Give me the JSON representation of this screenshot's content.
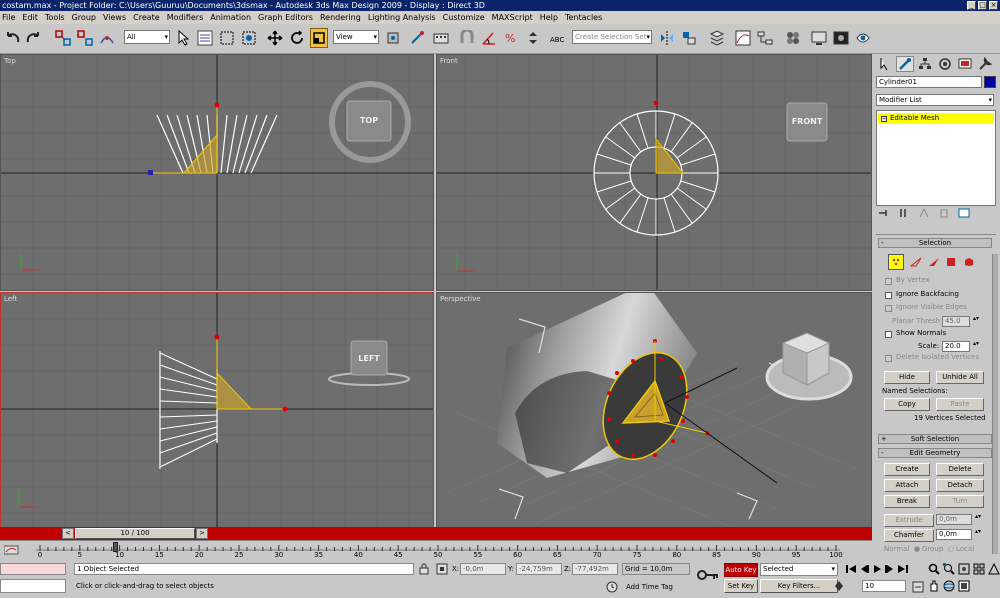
{
  "title": {
    "text": "costam.max    - Project Folder: C:\\Users\\Guuruu\\Documents\\3dsmax    - Autodesk 3ds Max Design 2009    - Display : Direct 3D"
  },
  "menu": [
    "File",
    "Edit",
    "Tools",
    "Group",
    "Views",
    "Create",
    "Modifiers",
    "Animation",
    "Graph Editors",
    "Rendering",
    "Lighting Analysis",
    "Customize",
    "MAXScript",
    "Help",
    "Tentacles"
  ],
  "toolbar": {
    "filter_value": "All",
    "refcoord_value": "View",
    "selection_set_placeholder": "Create Selection Set"
  },
  "viewports": {
    "top": {
      "label": "Top",
      "viewcube": "TOP"
    },
    "front": {
      "label": "Front",
      "viewcube": "FRONT"
    },
    "left": {
      "label": "Left",
      "viewcube": "LEFT"
    },
    "perspective": {
      "label": "Perspective"
    }
  },
  "panel": {
    "object_name": "Cylinder01",
    "modifier_list": "Modifier List",
    "stack_item": "Editable Mesh",
    "selection": {
      "title": "Selection",
      "by_vertex": "By Vertex",
      "ignore_backfacing": "Ignore Backfacing",
      "ignore_visible_edges": "Ignore Visible Edges",
      "planar_thresh_label": "Planar Thresh",
      "planar_thresh_value": "45.0",
      "show_normals": "Show Normals",
      "scale_label": "Scale:",
      "scale_value": "20.0",
      "delete_isolated": "Delete Isolated Vertices",
      "hide": "Hide",
      "unhide_all": "Unhide All",
      "named_selections": "Named Selections:",
      "copy": "Copy",
      "paste": "Paste",
      "status": "19 Vertices Selected"
    },
    "soft_selection": {
      "title": "Soft Selection"
    },
    "edit_geometry": {
      "title": "Edit Geometry",
      "create": "Create",
      "delete": "Delete",
      "attach": "Attach",
      "detach": "Detach",
      "break": "Break",
      "turn": "Turn",
      "extrude": "Extrude",
      "extrude_value": "0,0m",
      "chamfer": "Chamfer",
      "chamfer_value": "0,0m",
      "normal": "Normal",
      "group": "Group",
      "local": "Local"
    }
  },
  "timeline": {
    "frame_display": "10 / 100",
    "ticks": [
      "0",
      "5",
      "10",
      "15",
      "20",
      "25",
      "30",
      "35",
      "40",
      "45",
      "50",
      "55",
      "60",
      "65",
      "70",
      "75",
      "80",
      "85",
      "90",
      "95",
      "100"
    ],
    "current_frame": 10
  },
  "status": {
    "selection_text": "1 Object Selected",
    "prompt_text": "Click or click-and-drag to select objects",
    "x_label": "X:",
    "x_value": "-0,0m",
    "y_label": "Y:",
    "y_value": "-24,759m",
    "z_label": "Z:",
    "z_value": "-77,492m",
    "grid": "Grid = 10,0m",
    "add_time_tag": "Add Time Tag",
    "auto_key": "Auto Key",
    "set_key": "Set Key",
    "key_mode_value": "Selected",
    "key_filters": "Key Filters...",
    "frame_value": "10"
  },
  "colors": {
    "title_bg": "#0a246a",
    "timeline_red": "#c00000",
    "stack_yellow": "#ffff00",
    "active_viewport_border": "#c0302c",
    "mesh_white": "#ffffff",
    "selection_yellow": "#f0c800"
  }
}
